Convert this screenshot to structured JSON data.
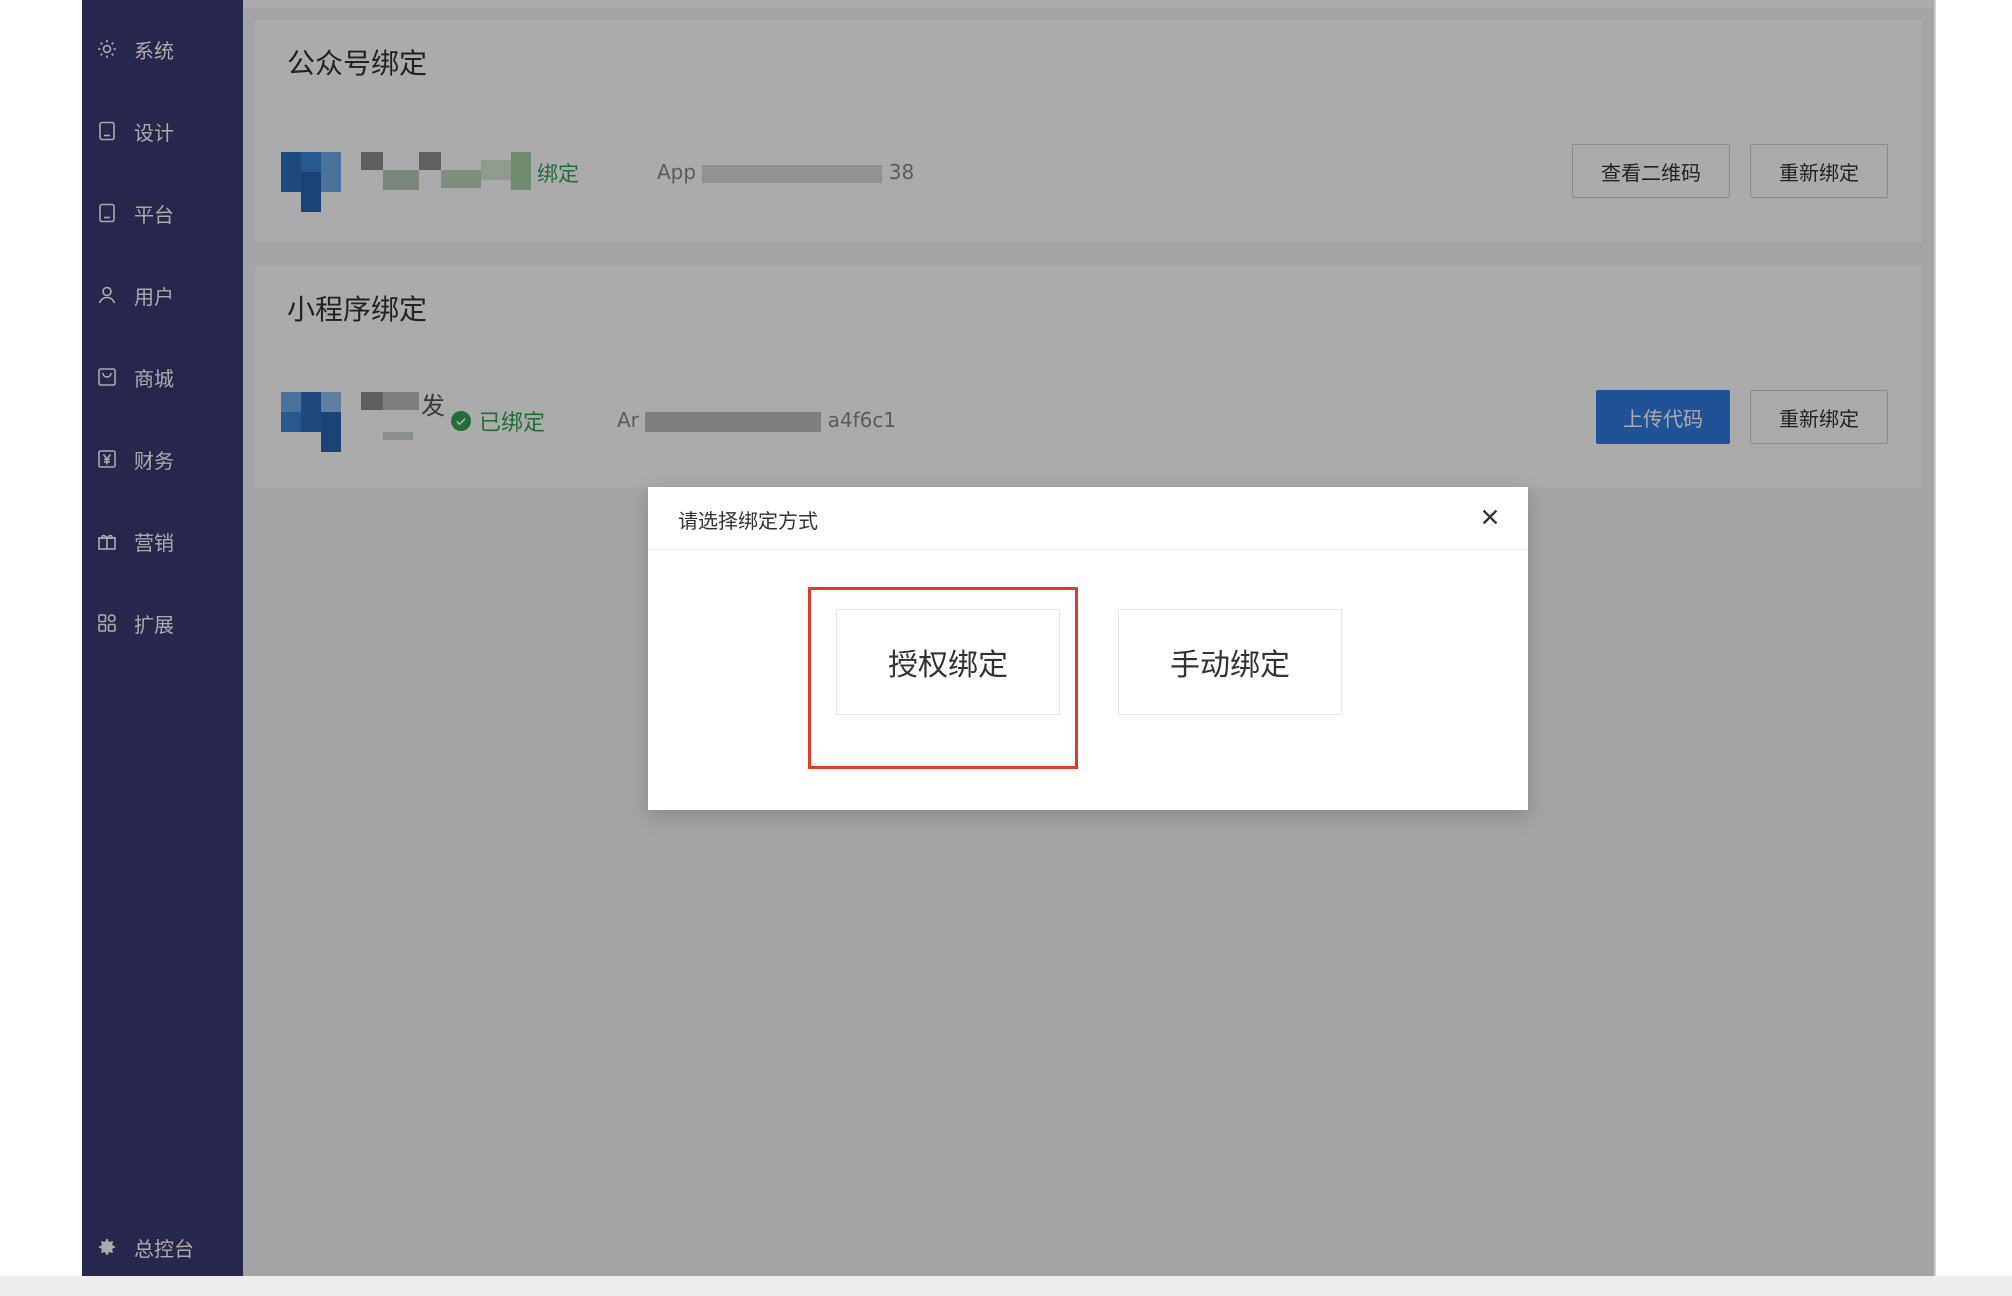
{
  "sidebar": {
    "items": [
      {
        "label": "系统",
        "icon": "gear-icon"
      },
      {
        "label": "设计",
        "icon": "tablet-icon"
      },
      {
        "label": "平台",
        "icon": "tablet-icon"
      },
      {
        "label": "用户",
        "icon": "user-icon"
      },
      {
        "label": "商城",
        "icon": "shop-icon"
      },
      {
        "label": "财务",
        "icon": "yen-icon"
      },
      {
        "label": "营销",
        "icon": "gift-icon"
      },
      {
        "label": "扩展",
        "icon": "grid-icon"
      }
    ],
    "footer": {
      "label": "总控台",
      "icon": "cog-icon"
    }
  },
  "cards": {
    "official": {
      "title": "公众号绑定",
      "status_text": "绑定",
      "appid_prefix": "App",
      "appid_suffix": "38",
      "buttons": {
        "view_qr": "查看二维码",
        "rebind": "重新绑定"
      }
    },
    "miniprogram": {
      "title": "小程序绑定",
      "name_suffix": "发",
      "status_text": "已绑定",
      "appid_prefix": "Ar",
      "appid_suffix": "a4f6c1",
      "buttons": {
        "upload": "上传代码",
        "rebind": "重新绑定"
      }
    }
  },
  "modal": {
    "title": "请选择绑定方式",
    "options": {
      "auth_bind": "授权绑定",
      "manual_bind": "手动绑定"
    },
    "highlight_color": "#e03a2d"
  },
  "colors": {
    "sidebar_bg": "#3b3970",
    "primary_blue": "#2f7be0",
    "success_green": "#2ea44f"
  }
}
